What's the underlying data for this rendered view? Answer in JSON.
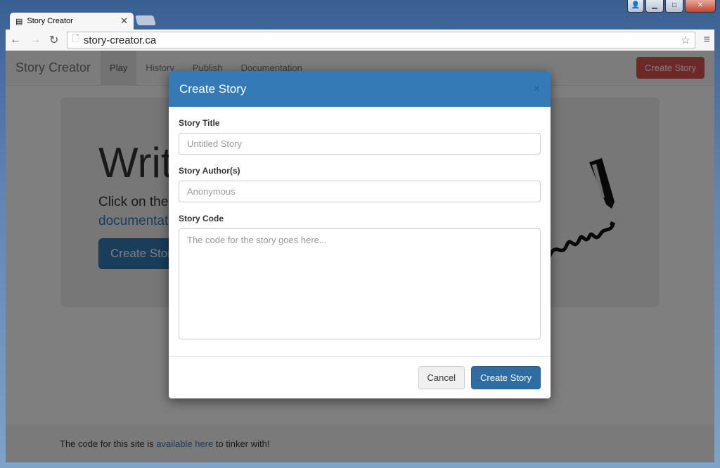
{
  "browser": {
    "tab_title": "Story Creator",
    "url": "story-creator.ca"
  },
  "navbar": {
    "brand": "Story Creator",
    "items": [
      "Play",
      "History",
      "Publish",
      "Documentation"
    ],
    "create_button": "Create Story"
  },
  "jumbotron": {
    "heading": "Write",
    "text": "Click on the",
    "link": "documentat",
    "button": "Create Story"
  },
  "footer": {
    "before": "The code for this site is ",
    "link": "available here",
    "after": " to tinker with!"
  },
  "modal": {
    "title": "Create Story",
    "close": "×",
    "fields": {
      "title_label": "Story Title",
      "title_placeholder": "Untitled Story",
      "author_label": "Story Author(s)",
      "author_placeholder": "Anonymous",
      "code_label": "Story Code",
      "code_placeholder": "The code for the story goes here..."
    },
    "cancel": "Cancel",
    "create": "Create Story"
  }
}
